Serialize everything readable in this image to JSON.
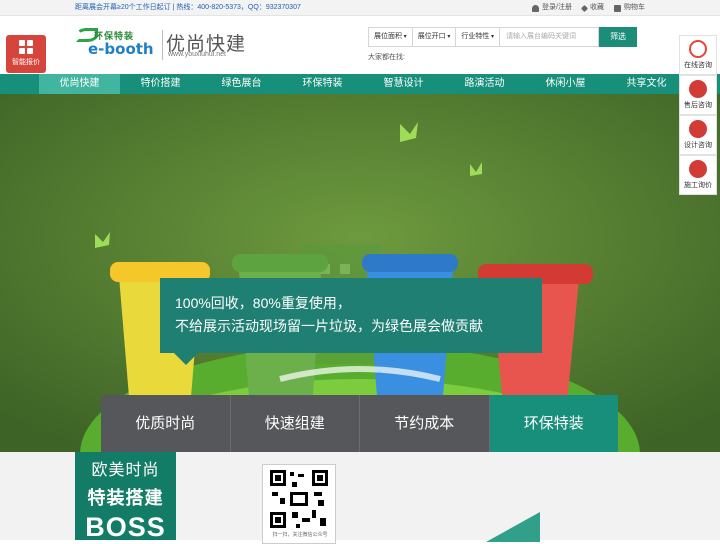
{
  "topbar": {
    "info": "距离展会开幕≥20个工作日起订 | 热线：400-820-5373，QQ：932370307",
    "login": "登录/注册",
    "favorite": "收藏",
    "cart": "购物车"
  },
  "quote_button": {
    "label": "智能报价"
  },
  "logo": {
    "brand_cn": "环保特装",
    "brand_en": "e-booth",
    "sub_cn": "优尚快建",
    "sub_en": "www.youxiuhui.net"
  },
  "search": {
    "filters": [
      "展位面积",
      "展位开口",
      "行业特性"
    ],
    "placeholder": "请输入展台编码关键词",
    "button": "筛选",
    "hot_label": "大家都在找:"
  },
  "nav": {
    "items": [
      "优尚快建",
      "特价搭建",
      "绿色展台",
      "环保特装",
      "智慧设计",
      "路演活动",
      "休闲小屋",
      "共享文化"
    ],
    "active": "优尚快建"
  },
  "banner": {
    "line1": "100%回收，80%重复使用，",
    "line2": "不给展示活动现场留一片垃圾，为绿色展会做贡献"
  },
  "tabs": {
    "items": [
      "优质时尚",
      "快速组建",
      "节约成本",
      "环保特装"
    ],
    "active": "环保特装"
  },
  "side": {
    "items": [
      "在线咨询",
      "售后咨询",
      "设计咨询",
      "施工询价"
    ]
  },
  "bottom": {
    "promo_line1": "欧美时尚",
    "promo_line2": "特装搭建",
    "promo_line3": "BOSS",
    "qr_caption": "扫一扫，关注微信公众号"
  }
}
